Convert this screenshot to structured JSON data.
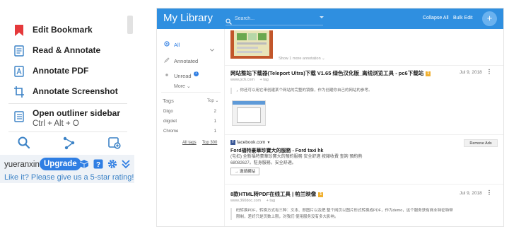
{
  "popup": {
    "menu": [
      {
        "label": "Edit Bookmark",
        "icon": "bookmark-icon"
      },
      {
        "label": "Read & Annotate",
        "icon": "document-icon"
      },
      {
        "label": "Annotate PDF",
        "icon": "pdf-icon"
      },
      {
        "label": "Annotate Screenshot",
        "icon": "crop-icon"
      },
      {
        "label": "Open outliner sidebar",
        "sublabel": "Ctrl + Alt + O",
        "icon": "outline-icon"
      }
    ],
    "tools": [
      "search-icon",
      "share-icon",
      "library-icon"
    ],
    "username": "yueranxin",
    "upgrade_label": "Upgrade",
    "rate_text": "Like it? Please give us a 5-star rating!",
    "colors": {
      "bookmark_red": "#e5393b",
      "accent_blue": "#2f7ee3",
      "icon_blue": "#3b82c6"
    }
  },
  "library": {
    "title": "My Library",
    "search_placeholder": "Search...",
    "collapse_all": "Collapse All",
    "bulk_edit": "Bulk Edit",
    "add_label": "+",
    "sidebar": {
      "all": "All",
      "annotated": "Annotated",
      "unread": "Unread",
      "unread_count": "1",
      "more": "More",
      "tags_heading": "Tags",
      "tags_sort": "Top",
      "tags": [
        {
          "name": "Diigo",
          "count": "2"
        },
        {
          "name": "diigolet",
          "count": "1"
        },
        {
          "name": "Chrome",
          "count": "1"
        }
      ],
      "all_tags": "All tags",
      "top_300": "Top 300"
    },
    "show_more_annotation": "Show 1 more annotation",
    "entries": [
      {
        "title": "网站整站下载器(Teleport Ultra)下载 V1.65 绿色汉化版_离线浏览工具 - pc6下载站",
        "badge": "1",
        "domain": "www.pc6.com",
        "tag_hint": "+ tag",
        "date": "Jul 9, 2018",
        "quote": "，你还可以用它来创建某个网站的完整的镜像，作为创建你自己的网站的参考。"
      },
      {
        "title": "8款HTML转PDF在线工具 | 帕兰映像",
        "badge": "1",
        "domain": "www.360doc.com",
        "tag_hint": "+ tag",
        "date": "Jul 9, 2018",
        "quote_line1": "码转换PDF，转换方式有三种：文本、即图片以及把 整个网页以图片形式转换成PDF，作为demo，这个服务获有商业特征特带",
        "quote_line2": "限制，差好只是页数上限，对我们 使用服务没有多大影响。"
      }
    ],
    "ad": {
      "source": "facebook.com",
      "remove_label": "Remove Ads",
      "title": "Ford福特豪華珍寶大的服務 - Ford taxi hk",
      "desc": "(屯扣) 全新福特豪華珍寶大的預約服務 安全舒適 按錶收費 查詢 預約熱 68082627。駐身服務，安全舒適。",
      "button": "→ 邀請網站"
    }
  }
}
